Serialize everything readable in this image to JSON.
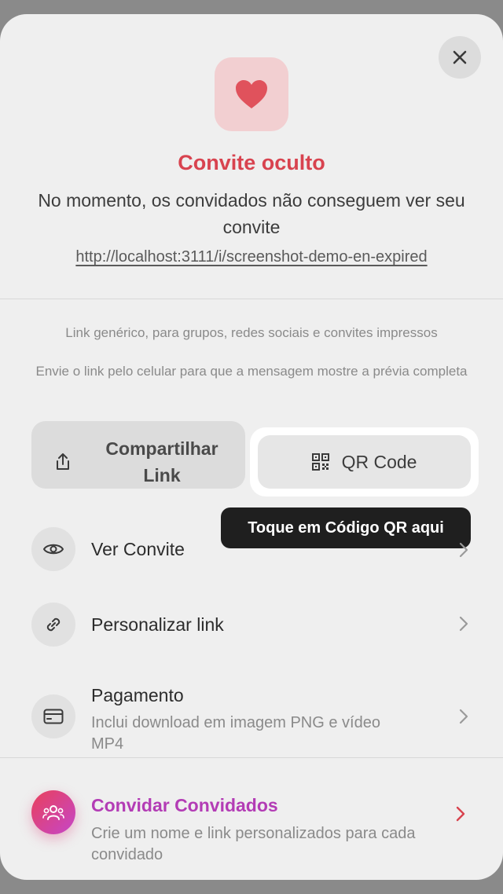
{
  "status": {
    "title": "Convite oculto",
    "description": "No momento, os convidados não conseguem ver seu convite",
    "link": "http://localhost:3111/i/screenshot-demo-en-expired"
  },
  "share": {
    "note_generic": "Link genérico, para grupos, redes sociais e convites impressos",
    "note_mobile": "Envie o link pelo celular para que a mensagem mostre a prévia completa",
    "share_label": "Compartilhar Link",
    "qr_label": "QR Code",
    "tooltip": "Toque em Código QR aqui"
  },
  "menu": {
    "view": {
      "title": "Ver Convite"
    },
    "customize": {
      "title": "Personalizar link"
    },
    "payment": {
      "title": "Pagamento",
      "subtitle": "Inclui download em imagem PNG e vídeo MP4"
    },
    "invite": {
      "title": "Convidar Convidados",
      "subtitle": "Crie um nome e link personalizados para cada convidado"
    }
  },
  "colors": {
    "accent_red": "#d8434f",
    "accent_purple": "#b33cb5",
    "tooltip_bg": "#1f1f1f"
  }
}
